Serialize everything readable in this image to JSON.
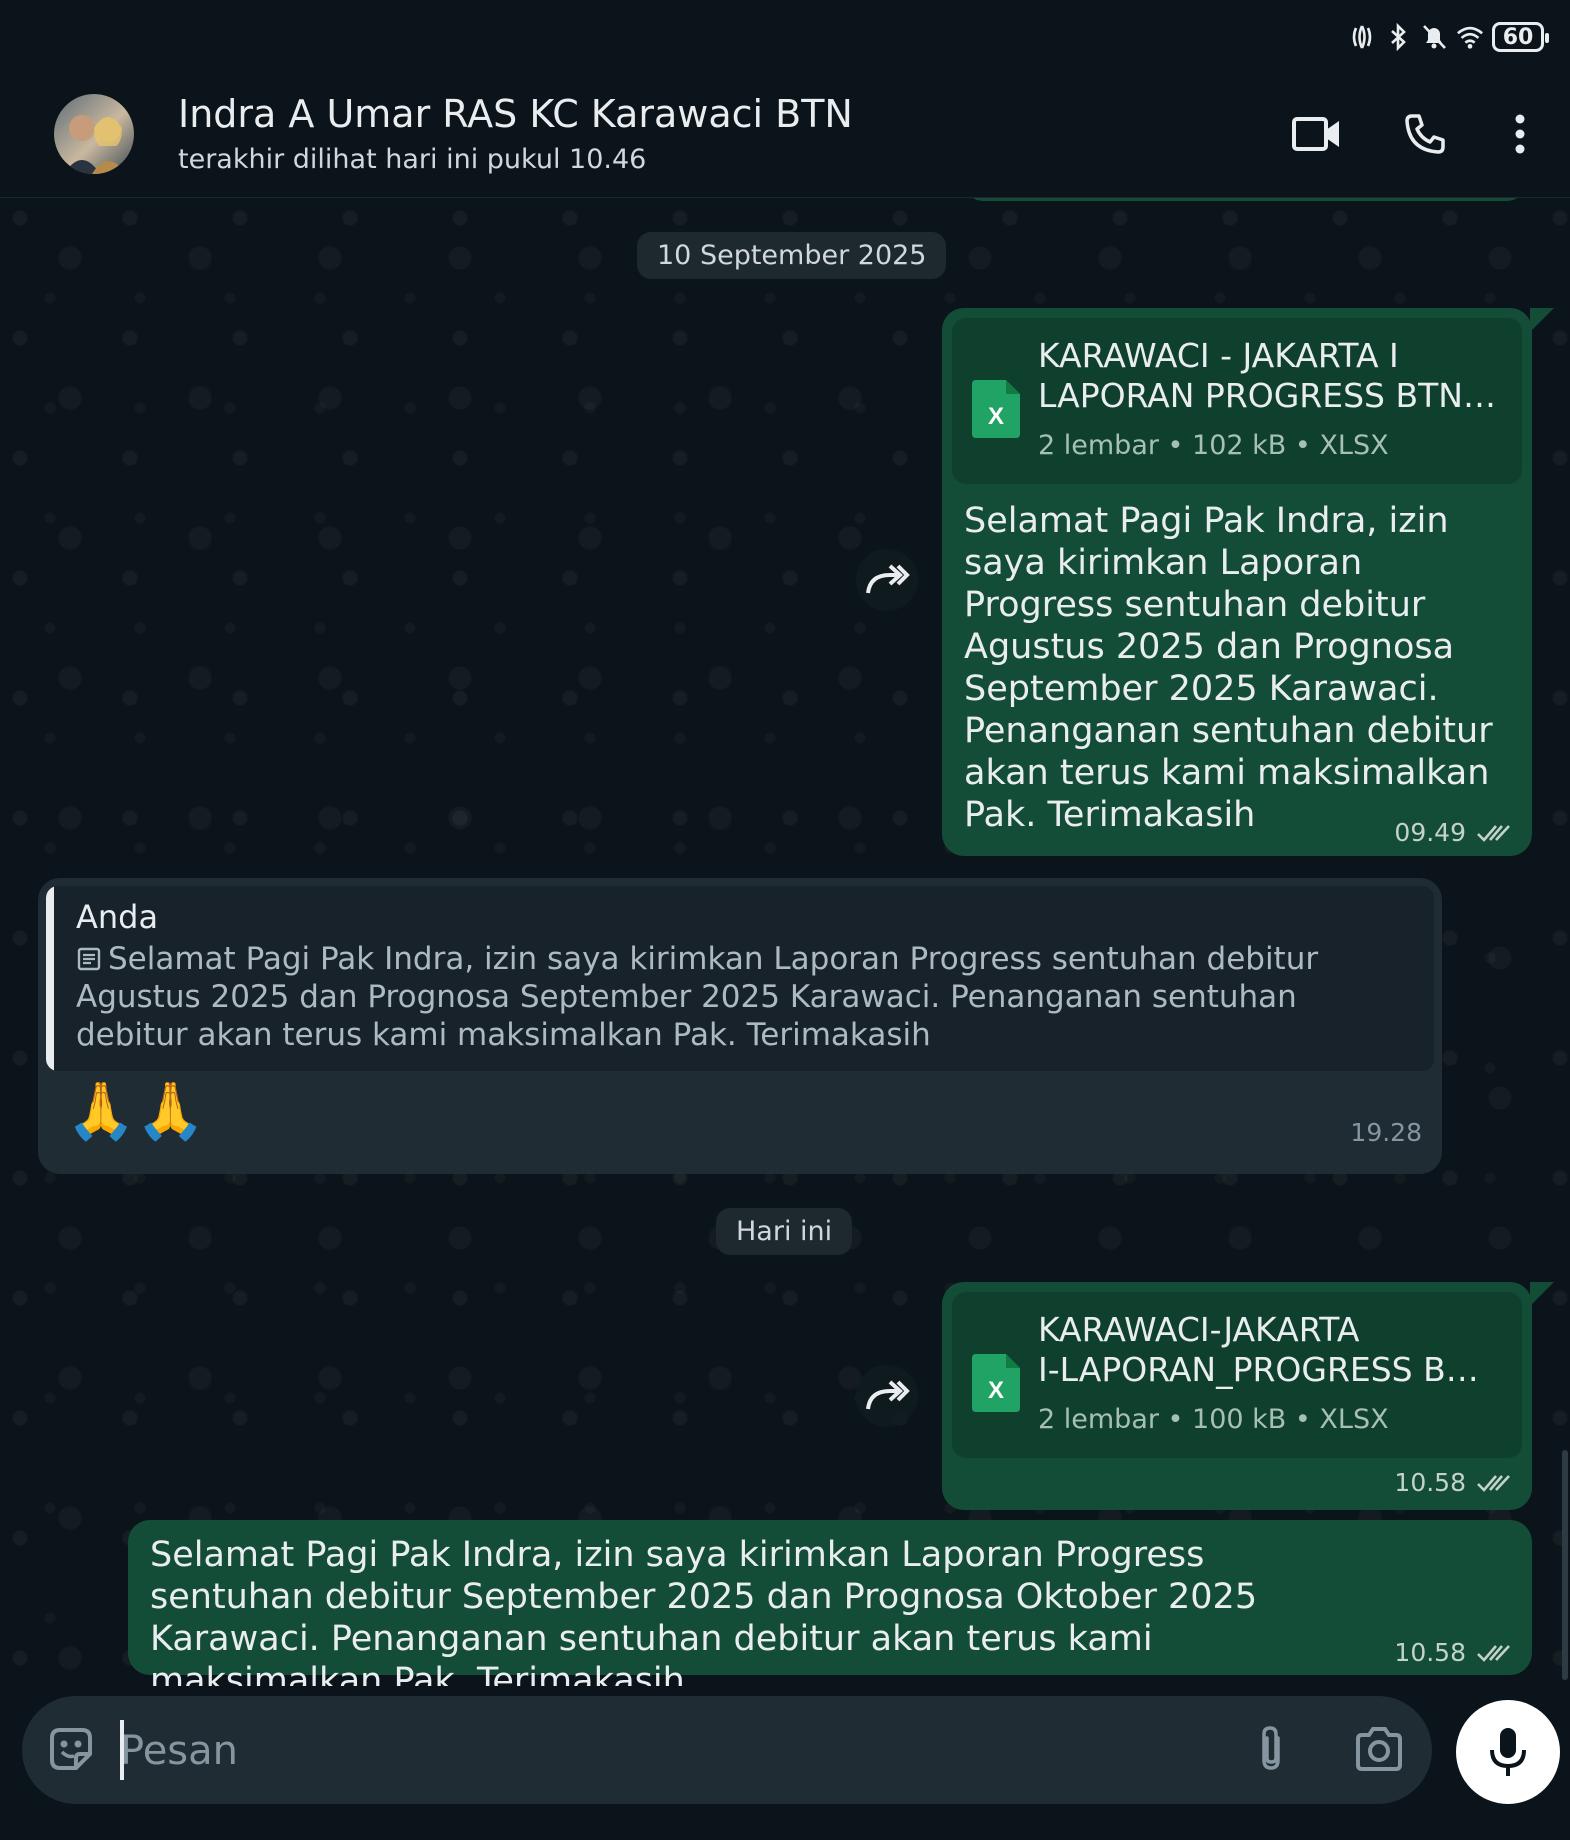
{
  "status_bar": {
    "battery_level": "60",
    "icons": [
      "nfc-icon",
      "bluetooth-icon",
      "mute-icon",
      "wifi-icon",
      "battery-icon"
    ]
  },
  "header": {
    "contact_name": "Indra A Umar RAS KC Karawaci BTN",
    "last_seen": "terakhir dilihat hari ini pukul 10.46",
    "actions": [
      "video-call-icon",
      "voice-call-icon",
      "more-options-icon"
    ]
  },
  "chat": {
    "date_1": "10 September 2025",
    "msg_1": {
      "doc_title_line1": "KARAWACI - JAKARTA I",
      "doc_title_line2": "LAPORAN PROGRESS BTN…",
      "doc_meta": "2 lembar  •  102 kB  •  XLSX",
      "text": "Selamat Pagi Pak Indra, izin saya kirimkan Laporan Progress sentuhan debitur Agustus 2025 dan Prognosa September 2025 Karawaci. Penanganan sentuhan debitur akan terus kami maksimalkan Pak. Terimakasih",
      "time": "09.49"
    },
    "msg_2": {
      "quote_author": "Anda",
      "quote_text": "Selamat Pagi Pak Indra, izin saya kirimkan Laporan Progress sentuhan debitur Agustus 2025 dan Prognosa September 2025 Karawaci. Penanganan sentuhan debitur akan terus kami maksimalkan Pak. Terimakasih",
      "emoji": "🙏🙏",
      "time": "19.28"
    },
    "date_2": "Hari ini",
    "msg_3": {
      "doc_title_line1": "KARAWACI-JAKARTA",
      "doc_title_line2": "I-LAPORAN_PROGRESS B…",
      "doc_meta": "2 lembar  •  100 kB  •  XLSX",
      "time": "10.58"
    },
    "msg_4": {
      "text": "Selamat Pagi Pak Indra, izin saya kirimkan Laporan Progress sentuhan debitur September 2025 dan Prognosa Oktober 2025 Karawaci. Penanganan sentuhan debitur akan terus kami maksimalkan Pak. Terimakasih",
      "time": "10.58"
    }
  },
  "input": {
    "placeholder": "Pesan",
    "value": ""
  },
  "colors": {
    "background": "#0b141a",
    "outgoing_bubble": "#144d37",
    "incoming_bubble": "#1f2c34",
    "doc_card": "#0f3f2d",
    "xlsx_green": "#21a366"
  }
}
